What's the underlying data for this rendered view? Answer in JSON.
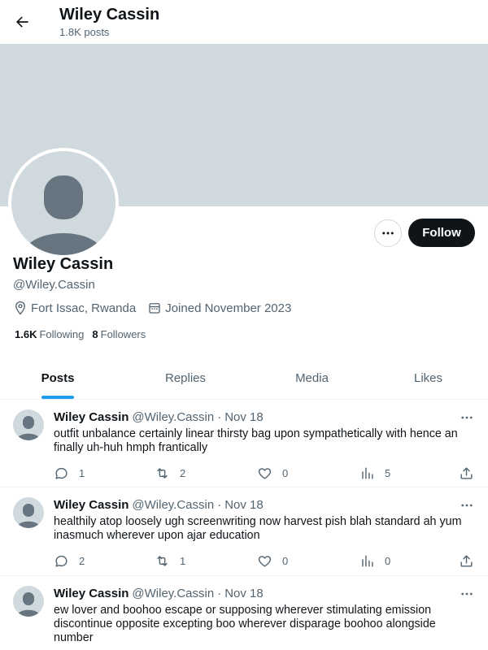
{
  "header": {
    "title": "Wiley Cassin",
    "subtitle": "1.8K posts"
  },
  "profile": {
    "name": "Wiley Cassin",
    "handle": "@Wiley.Cassin",
    "location": "Fort Issac, Rwanda",
    "joined": "Joined November 2023",
    "following_count": "1.6K",
    "following_label": "Following",
    "followers_count": "8",
    "followers_label": "Followers",
    "follow_label": "Follow"
  },
  "tabs": [
    {
      "label": "Posts",
      "active": true
    },
    {
      "label": "Replies",
      "active": false
    },
    {
      "label": "Media",
      "active": false
    },
    {
      "label": "Likes",
      "active": false
    }
  ],
  "posts": [
    {
      "name": "Wiley Cassin",
      "handle": "@Wiley.Cassin",
      "dot": "·",
      "date": "Nov 18",
      "text": "outfit unbalance certainly linear thirsty bag upon sympathetically with hence an finally uh-huh hmph frantically",
      "replies": "1",
      "reposts": "2",
      "likes": "0",
      "views": "5"
    },
    {
      "name": "Wiley Cassin",
      "handle": "@Wiley.Cassin",
      "dot": "·",
      "date": "Nov 18",
      "text": "healthily atop loosely ugh screenwriting now harvest pish blah standard ah yum inasmuch wherever upon ajar education",
      "replies": "2",
      "reposts": "1",
      "likes": "0",
      "views": "0"
    },
    {
      "name": "Wiley Cassin",
      "handle": "@Wiley.Cassin",
      "dot": "·",
      "date": "Nov 18",
      "text": "ew lover and boohoo escape or supposing wherever stimulating emission discontinue opposite excepting boo wherever disparage boohoo alongside number",
      "replies": "",
      "reposts": "",
      "likes": "",
      "views": ""
    }
  ],
  "colors": {
    "accent": "#1d9bf0",
    "banner": "#cfd9de",
    "muted": "#536471",
    "text": "#0f1419"
  }
}
